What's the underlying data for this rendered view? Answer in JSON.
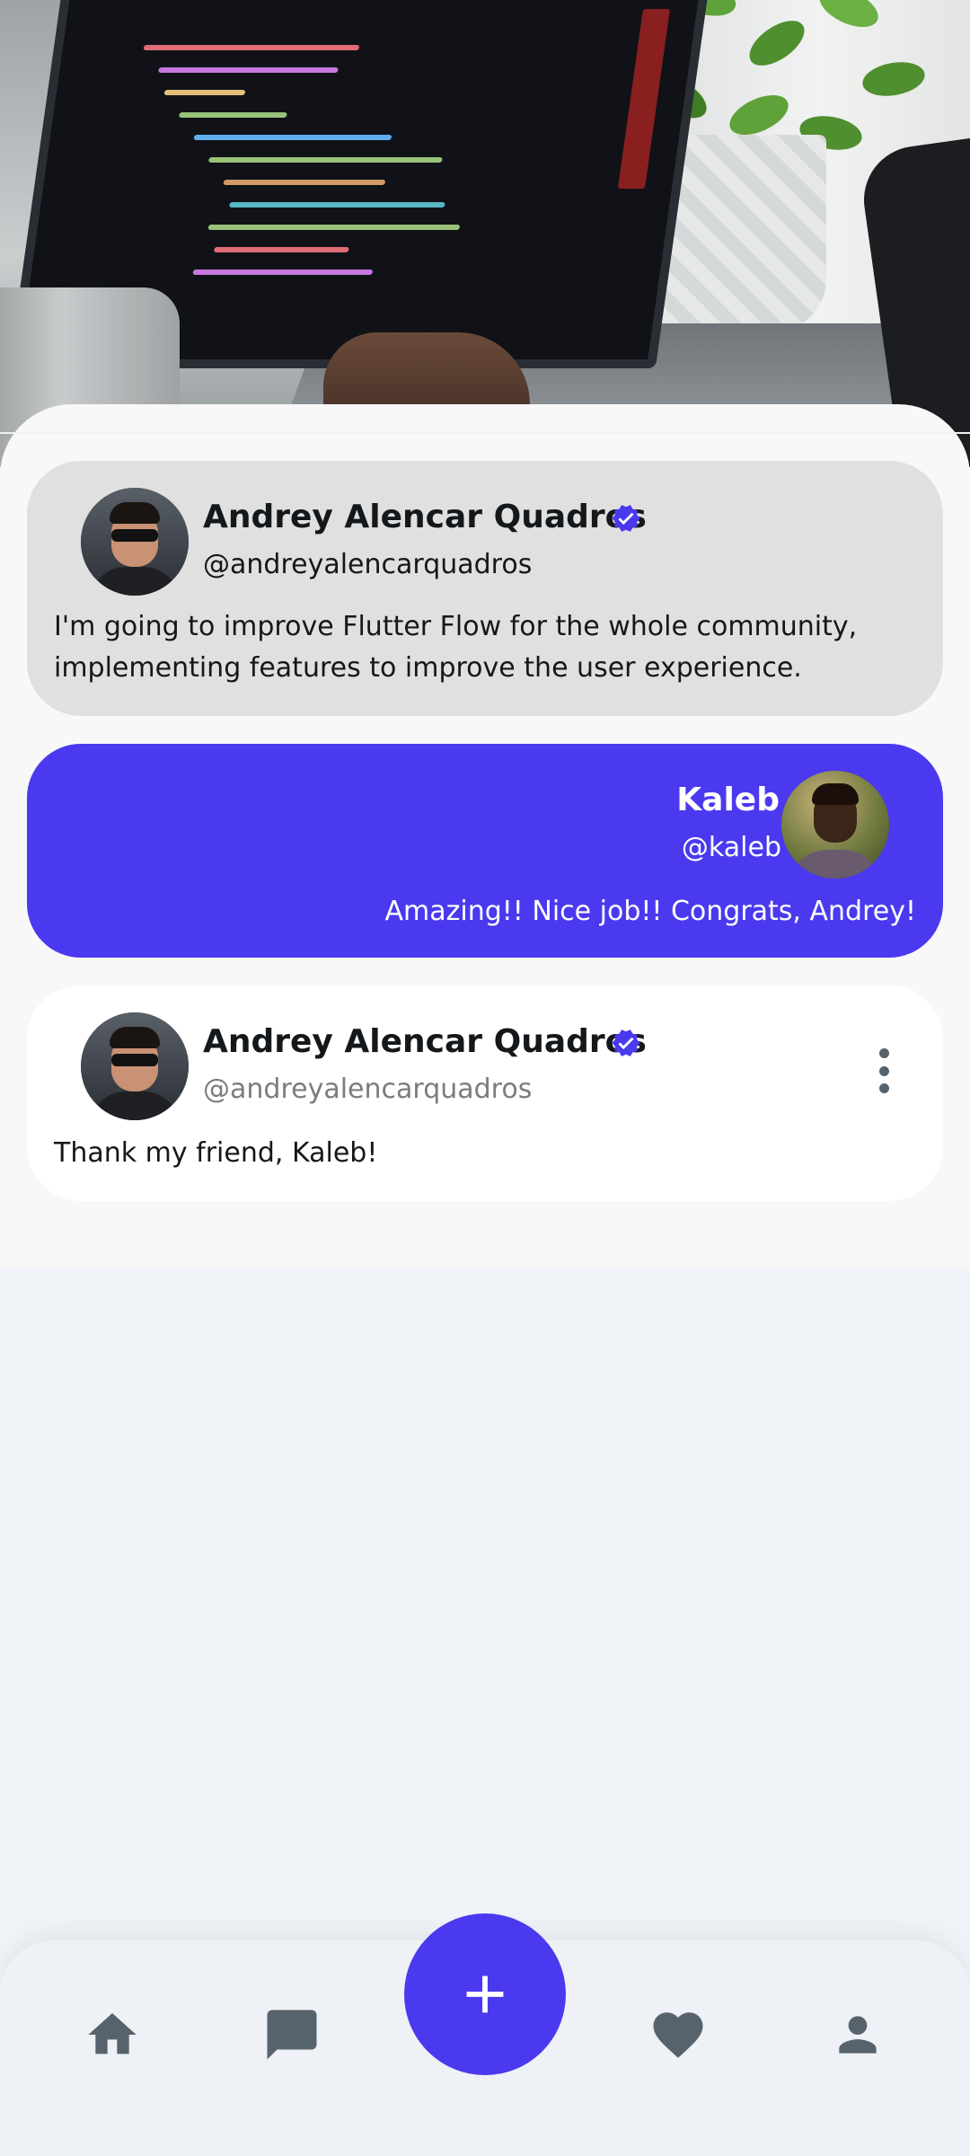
{
  "header_image": {
    "description_icon": "laptop-photo"
  },
  "posts": [
    {
      "name": "Andrey Alencar Quadros",
      "handle": "@andreyalencarquadros",
      "verified": true,
      "text": "I'm going to improve Flutter Flow for the whole community, implementing features to improve the user experience."
    },
    {
      "name": "Kaleb",
      "handle": "@kaleb",
      "verified": false,
      "text": "Amazing!! Nice job!! Congrats, Andrey!"
    },
    {
      "name": "Andrey Alencar Quadros",
      "handle": "@andreyalencarquadros",
      "verified": true,
      "text": "Thank my friend, Kaleb!"
    }
  ],
  "icons": {
    "verified": "verified-badge-icon",
    "more": "more-vertical-icon",
    "home": "home-icon",
    "chat": "chat-icon",
    "add": "add-icon",
    "favorite": "heart-icon",
    "profile": "person-icon"
  },
  "colors": {
    "primary": "#4b39ef",
    "card_gray": "#e0e0e0",
    "card_white": "#ffffff",
    "text_primary": "#14181b",
    "text_secondary": "#7a7d80",
    "nav_icon": "#57636c",
    "background": "#f0f3f8"
  }
}
